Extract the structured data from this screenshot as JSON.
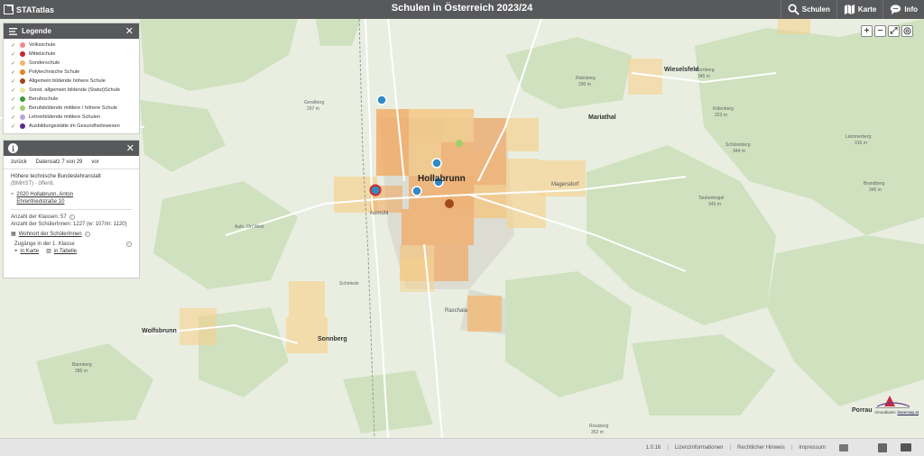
{
  "header": {
    "brand": "STATatlas",
    "title": "Schulen in Österreich 2023/24",
    "nav": [
      {
        "label": "Schulen",
        "icon": "search-icon"
      },
      {
        "label": "Karte",
        "icon": "map-icon"
      },
      {
        "label": "Info",
        "icon": "chat-icon"
      }
    ]
  },
  "legend": {
    "title": "Legende",
    "items": [
      {
        "label": "Volksschule",
        "color": "#f08a8a"
      },
      {
        "label": "Mittelschule",
        "color": "#c0272d"
      },
      {
        "label": "Sonderschule",
        "color": "#f5b26b"
      },
      {
        "label": "Polytechnische Schule",
        "color": "#e8801e"
      },
      {
        "label": "Allgemein bildende höhere Schule",
        "color": "#a0471c"
      },
      {
        "label": "Sonst. allgemein bildende (Statut)Schule",
        "color": "#e9e6a4"
      },
      {
        "label": "Berufsschule",
        "color": "#3a9a3a"
      },
      {
        "label": "Berufsbildende mittlere / höhere Schule",
        "color": "#9fd06a"
      },
      {
        "label": "Lehrerbildende mittlere Schulen",
        "color": "#b8a6d8"
      },
      {
        "label": "Ausbildungsstätte im Gesundheitswesen",
        "color": "#5a2a86"
      }
    ]
  },
  "info": {
    "nav_back": "zurück",
    "record": "Datensatz 7 von 29",
    "nav_next": "vor",
    "school_name": "Höhere technische Bundeslehranstalt",
    "school_abbr": "(BMHST) · öffentl.",
    "address_line1": "2020 Hollabrunn, Anton",
    "address_line2": "Ehrenfriedstraße 10",
    "classes": "Anzahl der Klassen: 57",
    "students": "Anzahl der SchülerInnen: 1227 (w: 107/m: 1120)",
    "residence_link": "Wohnort der SchülerInnen",
    "first_class": "Zugänge in der 1. Klasse",
    "in_map": "in Karte",
    "in_table": "in Tabelle"
  },
  "map": {
    "labels": {
      "hollabrunn": "Hollabrunn",
      "wieselsfeld": "Wieselsfeld",
      "mariathal": "Mariathal",
      "sonnberg": "Sonnberg",
      "wolfsbrunn": "Wolfsbrunn",
      "raschala": "Raschala",
      "porrau": "Porrau",
      "aumuhl": "Aumühl",
      "magersdorf": "Magersdorf",
      "gerstberg": "Gerstberg",
      "gerstberg_elev": "297 m",
      "rabsberg": "Rabsberg",
      "rabsberg_elev": "290 m",
      "kornberg": "Kornberg",
      "kornberg_elev": "345 m",
      "kittenberg": "Kittenberg",
      "kittenberg_elev": "323 m",
      "lammerberg": "Lämmerberg",
      "lammerberg_elev": "316 m",
      "schlossberg": "Schlossberg",
      "schlossberg_elev": "344 m",
      "taubenkogel": "Taubenkogel",
      "taubenkogel_elev": "343 m",
      "brandberg": "Brandberg",
      "brandberg_elev": "345 m",
      "bannberg": "Bannberg",
      "bannberg_elev": "285 m",
      "rossberg": "Rossberg",
      "rossberg_elev": "352 m",
      "aufn_ort_west": "Aufn. Ort West",
      "schinkele": "Schinkele"
    },
    "basemap_credit_prefix": "Grundkarte:",
    "basemap_credit_link": "basemap.at"
  },
  "controls": [
    "+",
    "−",
    "⤢",
    "◎"
  ],
  "footer": {
    "version": "1.0.16",
    "license": "Lizenzinformationen",
    "legal": "Rechtlicher Hinweis",
    "imprint": "Impressum"
  }
}
